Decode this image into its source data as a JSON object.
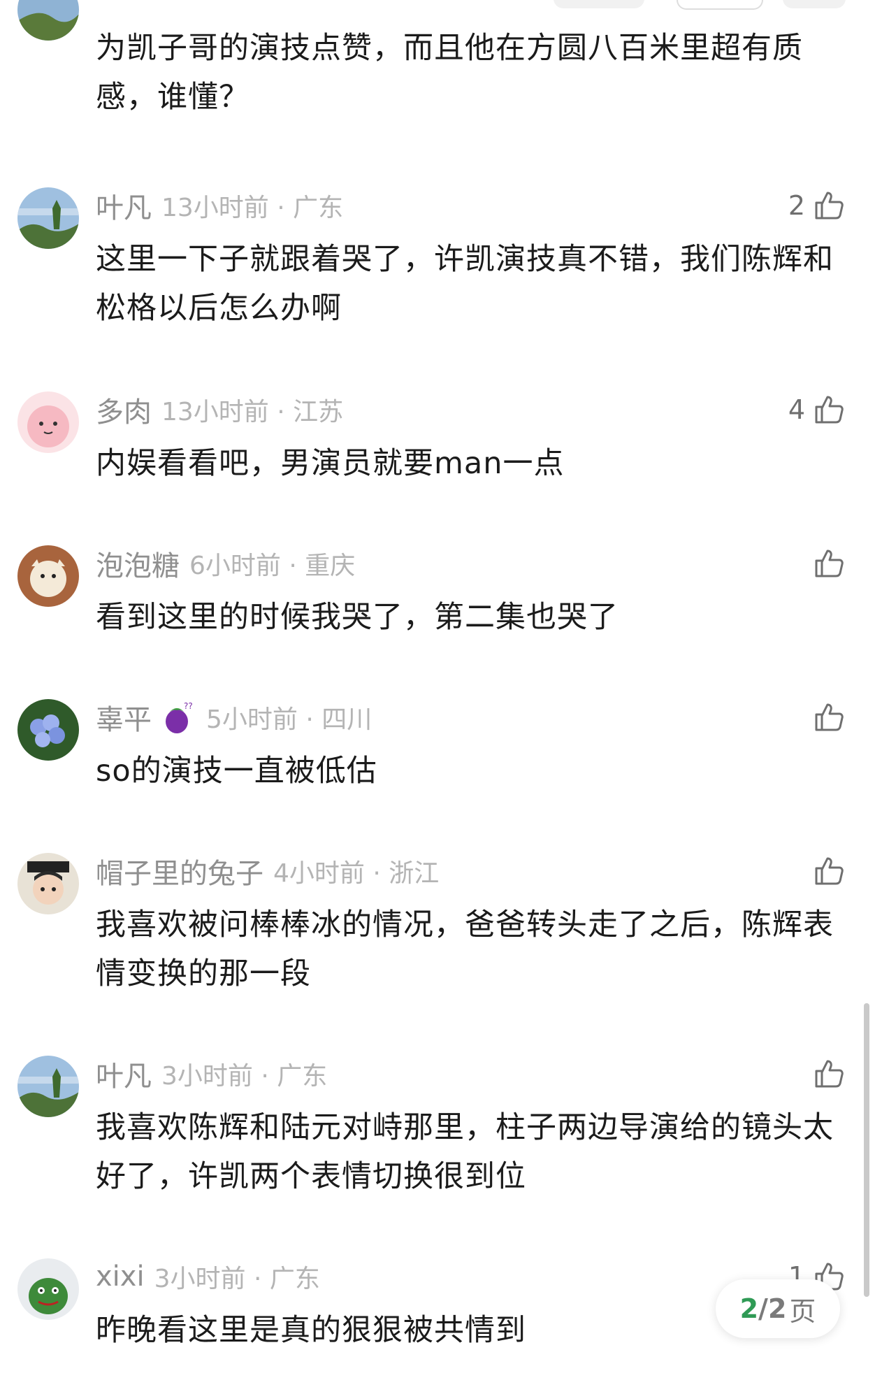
{
  "comments": [
    {
      "name": "",
      "time": "",
      "location": "",
      "likes": "",
      "text": "为凯子哥的演技点赞，而且他在方圆八百米里超有质感，谁懂？"
    },
    {
      "name": "叶凡",
      "time": "13小时前",
      "location": "· 广东",
      "likes": "2",
      "text": "这里一下子就跟着哭了，许凯演技真不错，我们陈辉和松格以后怎么办啊"
    },
    {
      "name": "多肉",
      "time": "13小时前",
      "location": "· 江苏",
      "likes": "4",
      "text": "内娱看看吧，男演员就要man一点"
    },
    {
      "name": "泡泡糖",
      "time": "6小时前",
      "location": "· 重庆",
      "likes": "",
      "text": "看到这里的时候我哭了，第二集也哭了"
    },
    {
      "name": "辜平",
      "badge": "eggplant-badge-icon",
      "time": "5小时前",
      "location": "· 四川",
      "likes": "",
      "text": "so的演技一直被低估"
    },
    {
      "name": "帽子里的兔子",
      "time": "4小时前",
      "location": "· 浙江",
      "likes": "",
      "text": "我喜欢被问棒棒冰的情况，爸爸转头走了之后，陈辉表情变换的那一段"
    },
    {
      "name": "叶凡",
      "time": "3小时前",
      "location": "· 广东",
      "likes": "",
      "text": "我喜欢陈辉和陆元对峙那里，柱子两边导演给的镜头太好了，许凯两个表情切换很到位"
    },
    {
      "name": "xixi",
      "time": "3小时前",
      "location": "· 广东",
      "likes": "1",
      "text": "昨晚看这里是真的狠狠被共情到"
    }
  ],
  "pager": {
    "current": "2",
    "separator": "/",
    "total": "2",
    "unit": "页"
  },
  "colors": {
    "accent": "#2f9a55",
    "meta": "#8f8f8f",
    "text": "#1b1b1b"
  }
}
